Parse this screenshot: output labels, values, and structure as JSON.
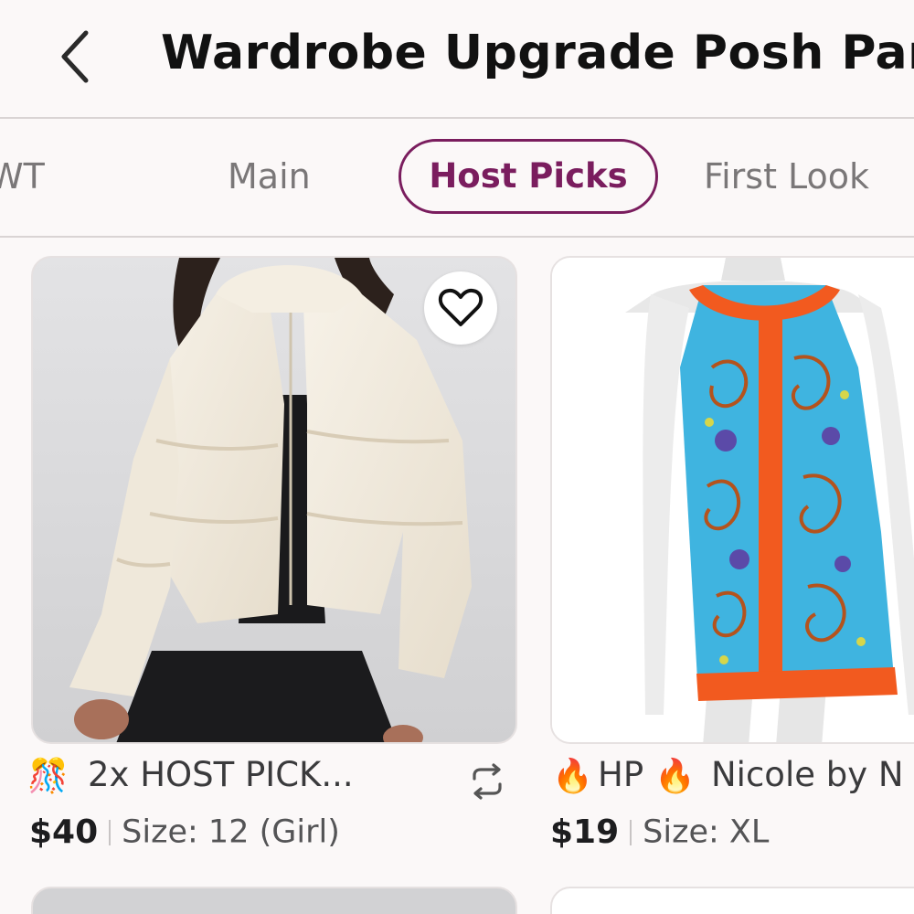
{
  "header": {
    "title": "Wardrobe Upgrade Posh Party",
    "back_icon": "chevron-left-icon"
  },
  "tabs": [
    {
      "label": "WT",
      "active": false
    },
    {
      "label": "Main",
      "active": false
    },
    {
      "label": "Host Picks",
      "active": true
    },
    {
      "label": "First Look",
      "active": false
    }
  ],
  "listings": [
    {
      "title": "2x HOST PICK...",
      "title_emoji": "🎊",
      "price": "$40",
      "size": "Size: 12 (Girl)",
      "liked": false,
      "image": "white-puffer-jacket"
    },
    {
      "title_prefix_emoji": "🔥",
      "title_hp": "HP",
      "title_suffix_emoji": "🔥",
      "title": "Nicole by N",
      "price": "$19",
      "size": "Size: XL",
      "image": "paisley-halter-top"
    }
  ],
  "colors": {
    "accent": "#7a1d5e",
    "background": "#fbf8f8",
    "text_primary": "#1d1d1f",
    "text_muted": "#7a7778"
  }
}
